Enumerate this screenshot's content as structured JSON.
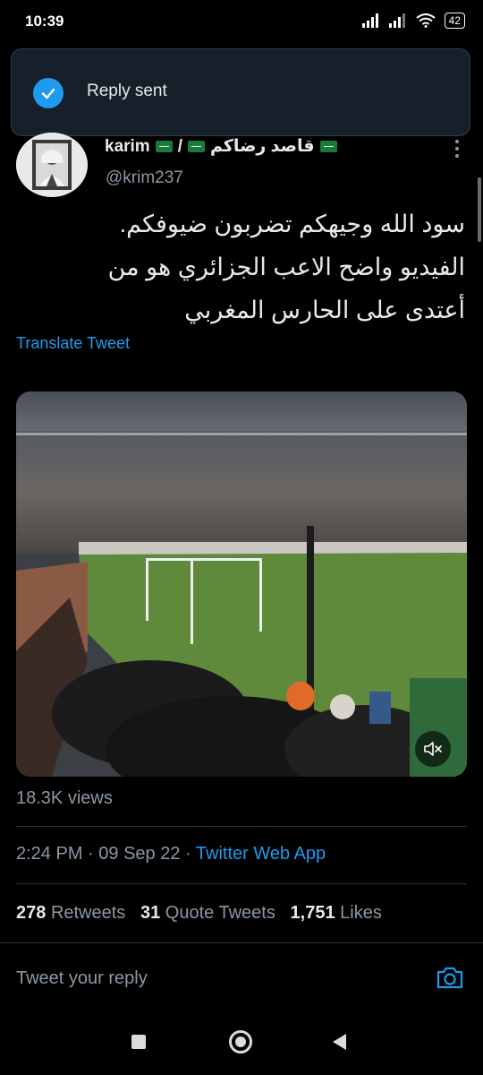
{
  "status_bar": {
    "time": "10:39",
    "battery": "42"
  },
  "toast": {
    "message": "Reply sent"
  },
  "tweet": {
    "author_name": "karim",
    "author_name_extra": "قاصد رضاكم",
    "separator": "/",
    "handle": "@krim237",
    "text_lines": [
      "سود الله وجيهكم تضربون ضيوفكم.",
      "الفيديو واضح الاعب الجزائري هو من",
      "أعتدى على الحارس المغربي"
    ],
    "translate_label": "Translate Tweet",
    "views": "18.3K views",
    "time": "2:24 PM",
    "date": "09 Sep 22",
    "source": "Twitter Web App",
    "retweets_count": "278",
    "retweets_label": "Retweets",
    "quotes_count": "31",
    "quotes_label": "Quote Tweets",
    "likes_count": "1,751",
    "likes_label": "Likes"
  },
  "reply": {
    "placeholder": "Tweet your reply"
  },
  "icons": {
    "check": "check-icon",
    "more": "more-vertical-icon",
    "mute": "volume-mute-icon",
    "camera": "camera-icon",
    "flag": "saudi-flag-icon"
  },
  "colors": {
    "accent": "#1d9bf0",
    "background": "#000000",
    "muted": "#8b98a5"
  }
}
